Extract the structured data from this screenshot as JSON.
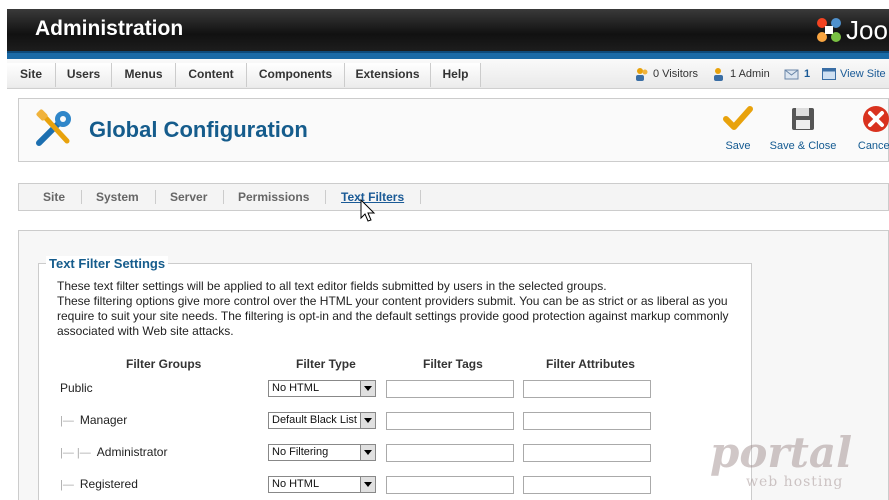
{
  "header": {
    "title": "Administration",
    "logo_text": "Joomla!"
  },
  "menu": {
    "items": [
      {
        "label": "Site"
      },
      {
        "label": "Users"
      },
      {
        "label": "Menus"
      },
      {
        "label": "Content"
      },
      {
        "label": "Components"
      },
      {
        "label": "Extensions"
      },
      {
        "label": "Help"
      }
    ],
    "status": {
      "visitors": "0 Visitors",
      "admins": "1 Admin",
      "messages": "1",
      "view_site": "View Site"
    }
  },
  "toolbar": {
    "title": "Global Configuration",
    "save_label": "Save",
    "save_close_label": "Save & Close",
    "cancel_label": "Cancel"
  },
  "tabs": [
    {
      "label": "Site"
    },
    {
      "label": "System"
    },
    {
      "label": "Server"
    },
    {
      "label": "Permissions"
    },
    {
      "label": "Text Filters",
      "active": true
    }
  ],
  "filters": {
    "legend": "Text Filter Settings",
    "description_1": "These text filter settings will be applied to all text editor fields submitted by users in the selected groups.",
    "description_2": "These filtering options give more control over the HTML your content providers submit. You can be as strict or as liberal as you require to suit your site needs. The filtering is opt-in and the default settings provide good protection against markup commonly associated with Web site attacks.",
    "columns": {
      "groups": "Filter Groups",
      "type": "Filter Type",
      "tags": "Filter Tags",
      "attributes": "Filter Attributes"
    },
    "rows": [
      {
        "group": "Public",
        "tree": "",
        "type": "No HTML",
        "tags": "",
        "attributes": ""
      },
      {
        "group": "Manager",
        "tree": "|—",
        "type": "Default Black List",
        "tags": "",
        "attributes": ""
      },
      {
        "group": "Administrator",
        "tree": "|— |—",
        "type": "No Filtering",
        "tags": "",
        "attributes": ""
      },
      {
        "group": "Registered",
        "tree": "|—",
        "type": "No HTML",
        "tags": "",
        "attributes": ""
      }
    ]
  },
  "watermark": {
    "line1": "portal",
    "line2": "web hosting"
  },
  "colors": {
    "brand_blue": "#155c8c",
    "link_blue": "#1a5a96",
    "save_orange": "#e8a20c",
    "cancel_red": "#d9321f"
  }
}
